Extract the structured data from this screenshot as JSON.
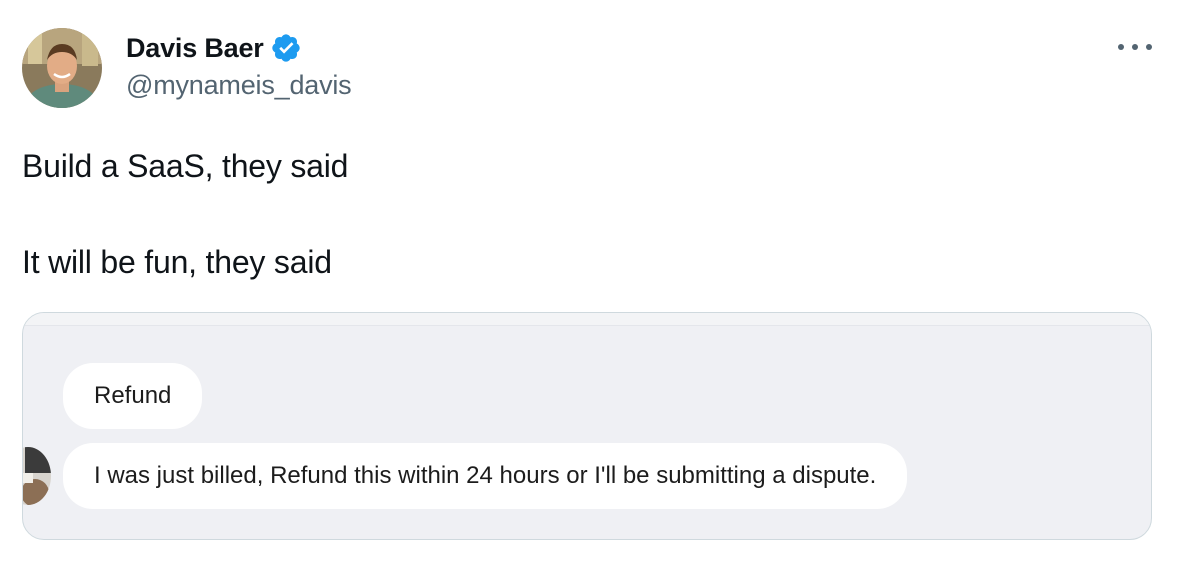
{
  "author": {
    "display_name": "Davis Baer",
    "handle": "@mynameis_davis",
    "verified": true,
    "verified_color": "#1d9bf0"
  },
  "tweet": {
    "line1": "Build a SaaS, they said",
    "line2": "It will be fun, they said"
  },
  "menu_icon": "more-horizontal-icon",
  "attachment": {
    "subject": "Refund",
    "message": "I was just billed, Refund this within 24 hours or I'll be submitting a dispute."
  }
}
